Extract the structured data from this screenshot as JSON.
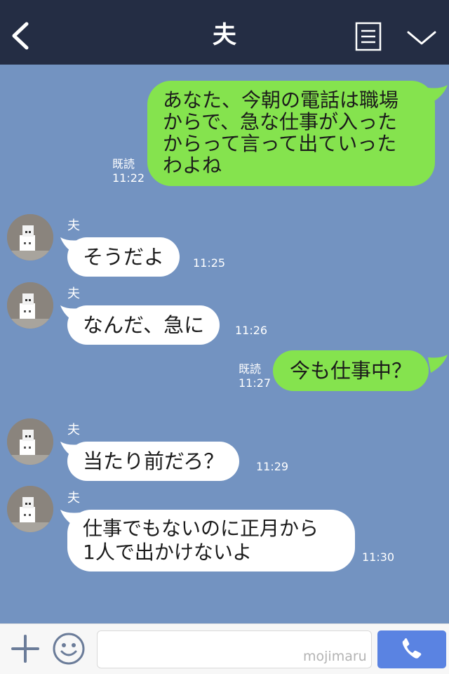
{
  "header": {
    "title": "夫"
  },
  "messages": {
    "m1": {
      "text_lines": [
        "あなた、今朝の電話は職場",
        "からで、急な仕事が入った",
        "からって言って出ていった",
        "わよね"
      ],
      "read": "既読",
      "time": "11:22"
    },
    "m2": {
      "sender": "夫",
      "text": "そうだよ",
      "time": "11:25"
    },
    "m3": {
      "sender": "夫",
      "text": "なんだ、急に",
      "time": "11:26"
    },
    "m4": {
      "text": "今も仕事中？",
      "read": "既読",
      "time": "11:27"
    },
    "m5": {
      "sender": "夫",
      "text": "当たり前だろ？",
      "time": "11:29"
    },
    "m6": {
      "sender": "夫",
      "text_lines": [
        "仕事でもないのに正月から",
        "1人で出かけないよ"
      ],
      "time": "11:30"
    }
  },
  "input": {
    "watermark": "mojimaru"
  },
  "colors": {
    "header_bg": "#242d44",
    "chat_bg": "#7393c1",
    "outgoing_bubble": "#85e34e",
    "incoming_bubble": "#ffffff",
    "call_button": "#5a83e2"
  },
  "icons": [
    "back-icon",
    "notes-icon",
    "chevron-down-icon",
    "plus-icon",
    "smile-icon",
    "phone-icon"
  ]
}
